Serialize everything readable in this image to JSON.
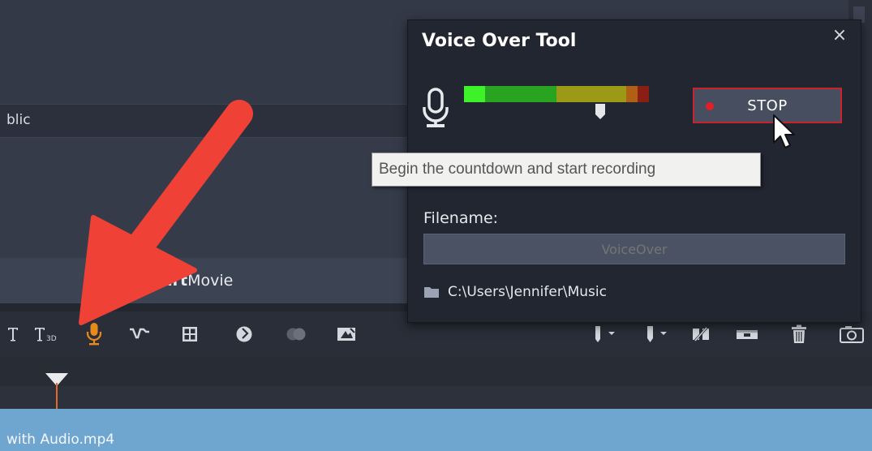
{
  "background": {
    "public_label": "blic",
    "smartmovie_bold": "mart",
    "smartmovie_rest": "Movie",
    "clip_label": "with Audio.mp4"
  },
  "toolbar": {
    "icons": [
      "title-icon",
      "3d-title-icon",
      "voice-over-microphone-icon",
      "audio-ducking-icon",
      "multi-camera-icon",
      "motion-tracking-icon",
      "masking-icon",
      "stop-motion-icon",
      "marker-icon",
      "chapter-marker-icon",
      "split-clip-icon",
      "trim-icon",
      "delete-icon",
      "snapshot-camera-icon"
    ],
    "active_color": "#e88a1a"
  },
  "voice_over": {
    "title": "Voice Over Tool",
    "close_label": "×",
    "stop_label": "STOP",
    "tooltip": "Begin the countdown and start recording",
    "filename_label": "Filename:",
    "filename_placeholder": "VoiceOver",
    "path": "C:\\Users\\Jennifer\\Music",
    "stop_border_color": "#c9232e",
    "record_dot_color": "#e01f26"
  },
  "annotation": {
    "arrow_color": "#ef4136"
  }
}
